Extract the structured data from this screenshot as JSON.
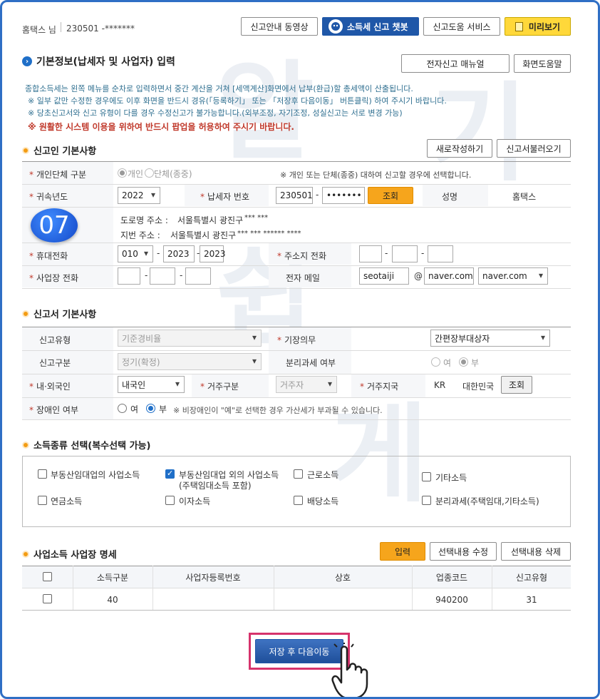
{
  "header": {
    "user": "홈택스 님",
    "id": "230501 -*******",
    "btn_guide_video": "신고안내 동영상",
    "btn_chatbot": "소득세 신고 챗봇",
    "btn_help_service": "신고도움 서비스",
    "btn_preview": "미리보기"
  },
  "main": {
    "title": "기본정보(납세자 및 사업자) 입력",
    "btn_manual": "전자신고 매뉴얼",
    "btn_screen_help": "화면도움말",
    "desc1": "종합소득세는 왼쪽 메뉴를 순차로 입력하면서 중간 계산을 거쳐 [세액계산]화면에서 납부(환급)할 총세액이 산출됩니다.",
    "desc2": "※ 일부 값만 수정한 경우에도 이후 화면을 반드시 경유(「등록하기」 또는 「저장후 다음이동」 버튼클릭) 하여 주시기 바랍니다.",
    "desc3": "※ 당초신고서와 신고 유형이 다를 경우 수정신고가 불가능합니다.(외부조정, 자기조정, 성실신고는 서로 변경 가능)",
    "warning": "※ 원활한 시스템 이용을 위하여 반드시 팝업을 허용하여 주시기 바랍니다."
  },
  "reporter": {
    "section_title": "신고인 기본사항",
    "btn_new": "새로작성하기",
    "btn_load": "신고서불러오기",
    "type_label": "개인단체 구분",
    "type_opt1": "개인",
    "type_opt2": "단체(종중)",
    "type_note": "※ 개인 또는 단체(종중) 대하여 신고할 경우에 선택합니다.",
    "year_label": "귀속년도",
    "year_value": "2022",
    "taxpayer_no_label": "납세자 번호",
    "taxpayer_no_front": "230501",
    "taxpayer_no_back": "•••••••",
    "btn_lookup": "조회",
    "name_label": "성명",
    "name_value": "홈택스",
    "badge": "07",
    "road_addr_label": "도로명 주소 :",
    "road_addr_value": "서울특별시 광진구",
    "road_addr_masked": "*** ***",
    "lot_addr_label": "지번 주소 :",
    "lot_addr_value": "서울특별시 광진구",
    "lot_addr_masked": "*** *** ****** ****",
    "mobile_label": "휴대전화",
    "mobile1": "010",
    "mobile2": "2023",
    "mobile3": "2023",
    "home_phone_label": "주소지 전화",
    "biz_phone_label": "사업장 전화",
    "email_label": "전자 메일",
    "email_id": "seotaiji",
    "email_at": "@",
    "email_domain": "naver.com",
    "email_domain_select": "naver.com"
  },
  "report": {
    "section_title": "신고서 기본사항",
    "type_label": "신고유형",
    "type_value": "기준경비율",
    "bookkeeping_label": "기장의무",
    "bookkeeping_value": "간편장부대상자",
    "category_label": "신고구분",
    "category_value": "정기(확정)",
    "separate_label": "분리과세 여부",
    "separate_yes": "여",
    "separate_no": "부",
    "nationality_label": "내·외국인",
    "nationality_value": "내국인",
    "residence_label": "거주구분",
    "residence_value": "거주자",
    "region_label": "거주지국",
    "region_code": "KR",
    "region_name": "대한민국",
    "btn_region_lookup": "조회",
    "disabled_label": "장애인 여부",
    "disabled_yes": "여",
    "disabled_no": "부",
    "disabled_note": "※ 비장애인이 \"예\"로 선택한 경우 가산세가 부과될 수 있습니다."
  },
  "income": {
    "section_title": "소득종류 선택(복수선택 가능)",
    "opt1": "부동산임대업의 사업소득",
    "opt2": "부동산임대업 외의 사업소득",
    "opt2_sub": "(주택임대소득 포함)",
    "opt3": "근로소득",
    "opt4": "기타소득",
    "opt5": "연금소득",
    "opt6": "이자소득",
    "opt7": "배당소득",
    "opt8": "분리과세(주택임대,기타소득)"
  },
  "business": {
    "section_title": "사업소득 사업장 명세",
    "btn_input": "입력",
    "btn_edit": "선택내용 수정",
    "btn_delete": "선택내용 삭제",
    "columns": [
      "소득구분",
      "사업자등록번호",
      "상호",
      "업종코드",
      "신고유형"
    ],
    "rows": [
      {
        "income_type": "40",
        "biz_no": "",
        "name": "",
        "code": "940200",
        "report_type": "31"
      }
    ]
  },
  "footer": {
    "btn_save_next": "저장 후 다음이동"
  },
  "watermark": [
    "알",
    "기",
    "쉽",
    "게"
  ],
  "colors": {
    "accent": "#1f57a8",
    "orange": "#f6a51c",
    "highlight": "#d6336c"
  }
}
